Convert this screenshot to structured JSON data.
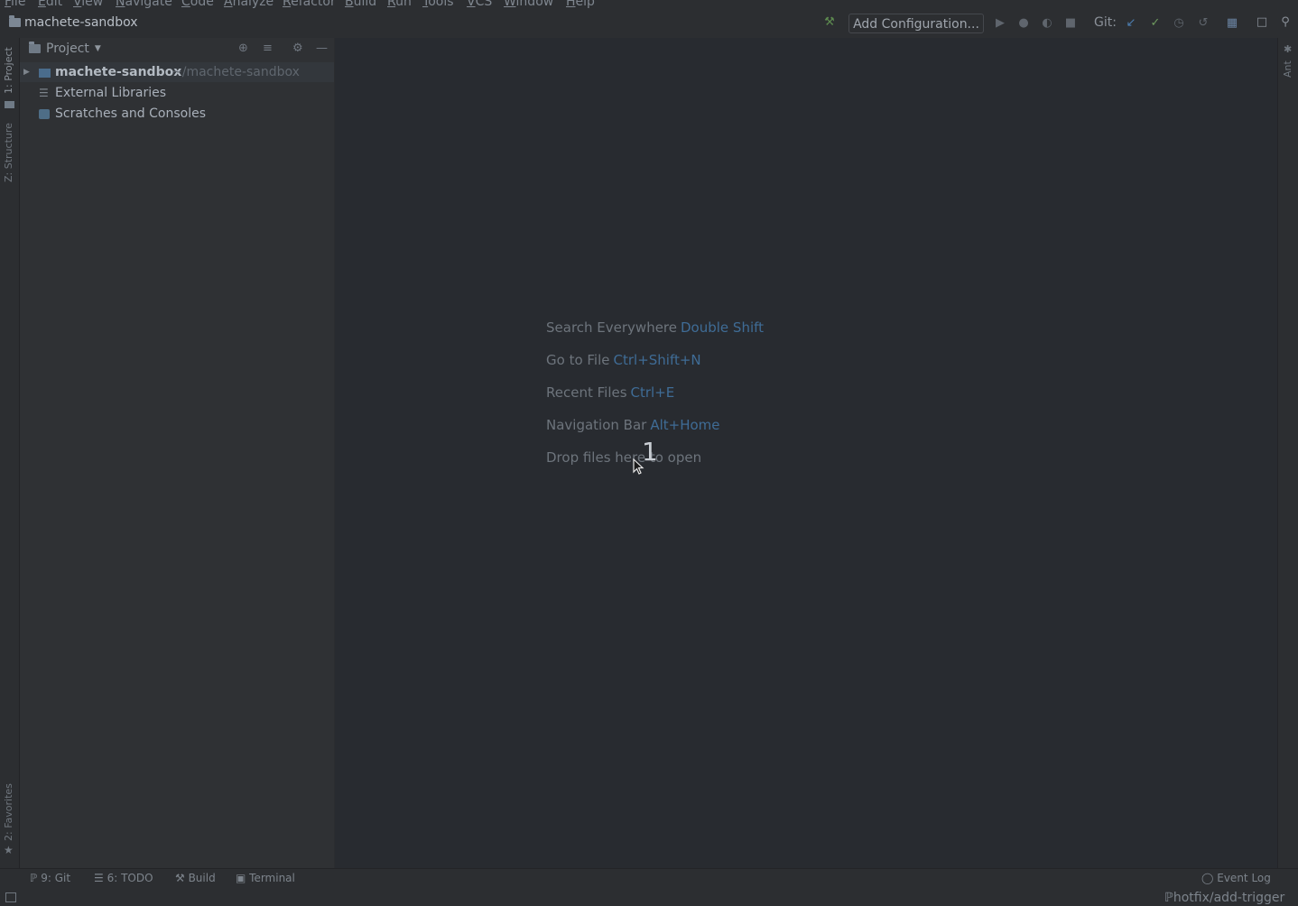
{
  "menu": [
    "File",
    "Edit",
    "View",
    "Navigate",
    "Code",
    "Analyze",
    "Refactor",
    "Build",
    "Run",
    "Tools",
    "VCS",
    "Window",
    "Help"
  ],
  "navbar": {
    "project_name": "machete-sandbox",
    "add_configuration": "Add Configuration...",
    "git_label": "Git:"
  },
  "left_stripe": {
    "project": "1: Project",
    "structure": "Z: Structure",
    "favorites": "2: Favorites"
  },
  "right_stripe": {
    "ant": "Ant"
  },
  "project_panel": {
    "title": "Project",
    "tree": [
      {
        "name": "machete-sandbox",
        "path": "~/machete-sandbox"
      },
      {
        "name": "External Libraries"
      },
      {
        "name": "Scratches and Consoles"
      }
    ]
  },
  "editor": {
    "hints": [
      {
        "label": "Search Everywhere",
        "key": "Double Shift"
      },
      {
        "label": "Go to File",
        "key": "Ctrl+Shift+N"
      },
      {
        "label": "Recent Files",
        "key": "Ctrl+E"
      },
      {
        "label": "Navigation Bar",
        "key": "Alt+Home"
      },
      {
        "label": "Drop files here to open",
        "key": ""
      }
    ],
    "overlay_number": "1"
  },
  "bottom_tabs": {
    "git": "9: Git",
    "todo": "6: TODO",
    "build": "Build",
    "terminal": "Terminal",
    "event_log": "Event Log"
  },
  "status": {
    "branch": "hotfix/add-trigger"
  },
  "colors": {
    "key_accent": "#3f6c96",
    "selection": "#33373c",
    "folder_blue": "#4a6c8c"
  }
}
